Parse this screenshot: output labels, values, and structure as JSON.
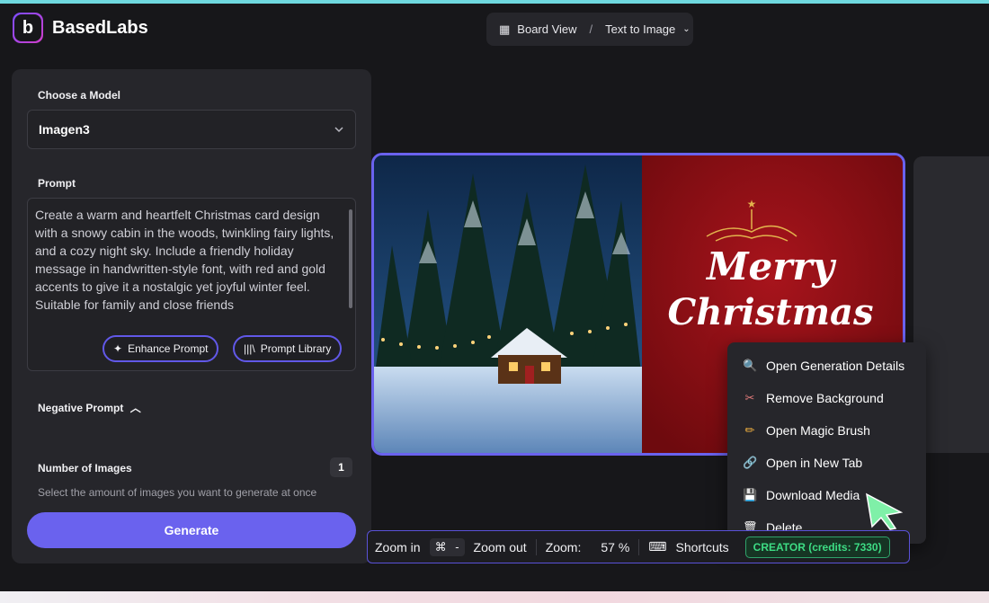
{
  "app": {
    "name": "BasedLabs",
    "logo_letter": "b"
  },
  "breadcrumb": {
    "board": "Board View",
    "sep": "/",
    "current": "Text to Image"
  },
  "model": {
    "label": "Choose a Model",
    "value": "Imagen3"
  },
  "prompt": {
    "label": "Prompt",
    "value": "Create a warm and heartfelt Christmas card design with a snowy cabin in the woods, twinkling fairy lights, and a cozy night sky. Include a friendly holiday message in handwritten-style font, with red and gold accents to give it a nostalgic yet joyful winter feel. Suitable for family and close friends",
    "enhance_label": "Enhance Prompt",
    "library_label": "Prompt Library"
  },
  "negative_prompt": {
    "label": "Negative Prompt"
  },
  "images": {
    "label": "Number of Images",
    "count": "1",
    "helper": "Select the amount of images you want to generate at once"
  },
  "generate_label": "Generate",
  "card": {
    "line1": "Merry",
    "line2": "Christmas"
  },
  "context_menu": [
    {
      "icon": "search-icon",
      "glyph": "🔍",
      "label": "Open Generation Details"
    },
    {
      "icon": "scissors-icon",
      "glyph": "✂",
      "label": "Remove Background"
    },
    {
      "icon": "brush-icon",
      "glyph": "✏",
      "label": "Open Magic Brush"
    },
    {
      "icon": "link-icon",
      "glyph": "🔗",
      "label": "Open in New Tab"
    },
    {
      "icon": "floppy-icon",
      "glyph": "💾",
      "label": "Download Media"
    },
    {
      "icon": "trash-icon",
      "glyph": "🗑",
      "label": "Delete"
    }
  ],
  "zoom": {
    "zoom_in": "Zoom in",
    "cmd": "⌘",
    "minus": "-",
    "zoom_out": "Zoom out",
    "zoom_label": "Zoom:",
    "zoom_value": "57 %",
    "shortcuts": "Shortcuts",
    "credits": "CREATOR (credits: 7330)"
  },
  "colors": {
    "accent": "#6a62ee",
    "credits_green": "#3ddc84",
    "card_red": "#8e0d12",
    "gold": "#e2b24c"
  }
}
